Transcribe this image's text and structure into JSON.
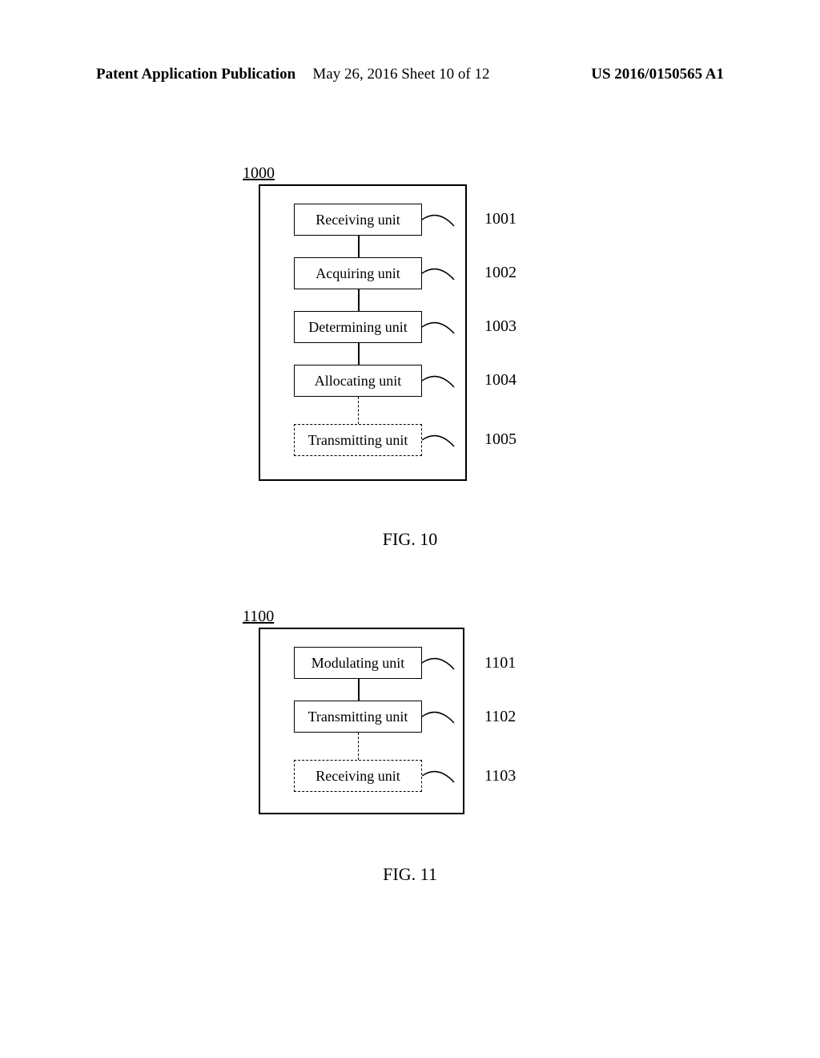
{
  "header": {
    "left": "Patent Application Publication",
    "center": "May 26, 2016  Sheet 10 of 12",
    "right": "US 2016/0150565 A1"
  },
  "figure10": {
    "ref_label": "1000",
    "fig_label": "FIG. 10",
    "units": [
      {
        "label": "Receiving unit",
        "ref": "1001"
      },
      {
        "label": "Acquiring unit",
        "ref": "1002"
      },
      {
        "label": "Determining unit",
        "ref": "1003"
      },
      {
        "label": "Allocating unit",
        "ref": "1004"
      },
      {
        "label": "Transmitting unit",
        "ref": "1005"
      }
    ]
  },
  "figure11": {
    "ref_label": "1100",
    "fig_label": "FIG. 11",
    "units": [
      {
        "label": "Modulating unit",
        "ref": "1101"
      },
      {
        "label": "Transmitting unit",
        "ref": "1102"
      },
      {
        "label": "Receiving unit",
        "ref": "1103"
      }
    ]
  }
}
